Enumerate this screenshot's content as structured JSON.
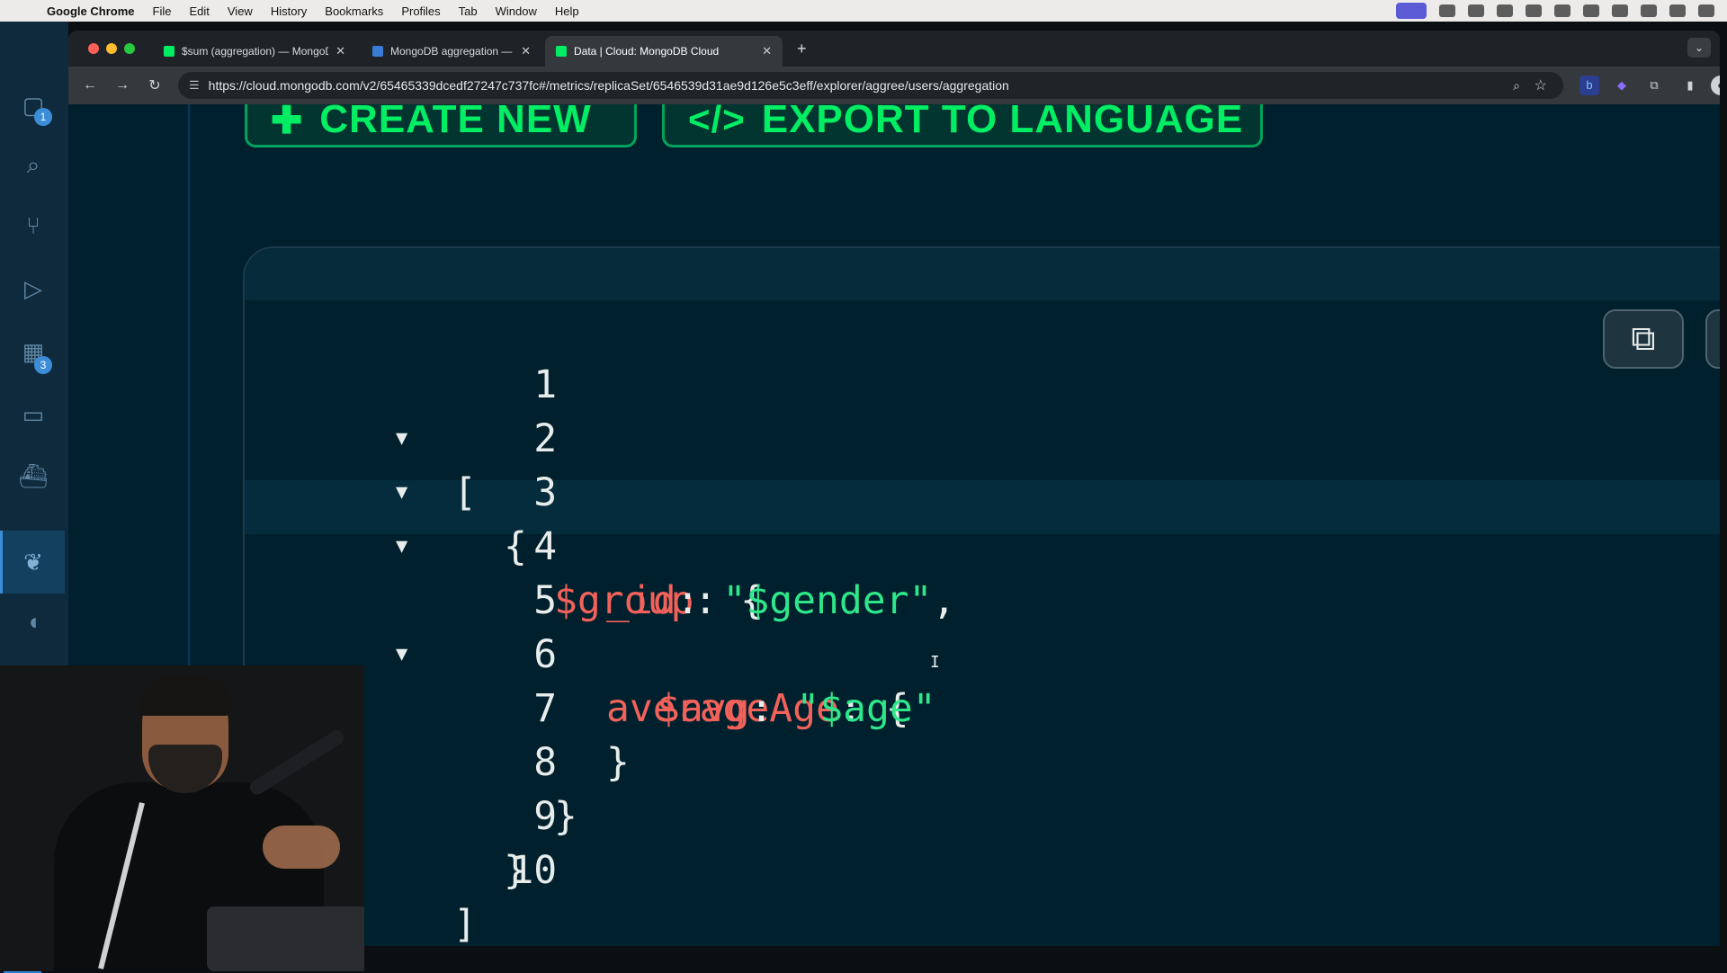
{
  "menubar": {
    "app": "Google Chrome",
    "items": [
      "File",
      "Edit",
      "View",
      "History",
      "Bookmarks",
      "Profiles",
      "Tab",
      "Window",
      "Help"
    ]
  },
  "activity_bar": {
    "explorer_badge": "1",
    "extensions_badge": "3"
  },
  "tabs": [
    {
      "title": "$sum (aggregation) — MongoDB",
      "favicon_color": "#00ed64"
    },
    {
      "title": "MongoDB aggregation — Era",
      "favicon_color": "#3a7bd5"
    },
    {
      "title": "Data | Cloud: MongoDB Cloud",
      "favicon_color": "#00ed64",
      "active": true
    }
  ],
  "url": "https://cloud.mongodb.com/v2/65465339dcedf27247c737fc#/metrics/replicaSet/6546539d31ae9d126e5c3eff/explorer/aggree/users/aggregation",
  "buttons": {
    "create_new": "CREATE NEW",
    "export_to_language": "EXPORT TO LANGUAGE"
  },
  "editor": {
    "lines": [
      {
        "n": "1",
        "fold": true
      },
      {
        "n": "2",
        "fold": true
      },
      {
        "n": "3",
        "fold": true
      },
      {
        "n": "4",
        "fold": false
      },
      {
        "n": "5",
        "fold": true
      },
      {
        "n": "6",
        "fold": false
      },
      {
        "n": "7",
        "fold": false
      },
      {
        "n": "8",
        "fold": false
      },
      {
        "n": "9",
        "fold": false
      },
      {
        "n": "10",
        "fold": false
      }
    ],
    "code": {
      "l1_open": "[",
      "l2_open": "{",
      "l3_key": "$group",
      "l3_rest": ": {",
      "l4_key": "_id",
      "l4_colon": ": ",
      "l4_val": "\"$gender\"",
      "l4_comma": ",",
      "l5_key": "averageAge",
      "l5_rest": ": {",
      "l6_key": "$avg",
      "l6_colon": ": ",
      "l6_val": "\"$age\"",
      "l7_close": "}",
      "l8_close": "}",
      "l9_close": "}",
      "l10_close": "]"
    }
  },
  "colors": {
    "page_bg": "#00202d",
    "accent_green": "#00ed64",
    "key_red": "#f2625b",
    "string_green": "#2fe68a"
  },
  "icons": [
    "copy-icon",
    "menu-icon",
    "plus-icon",
    "code-icon"
  ]
}
